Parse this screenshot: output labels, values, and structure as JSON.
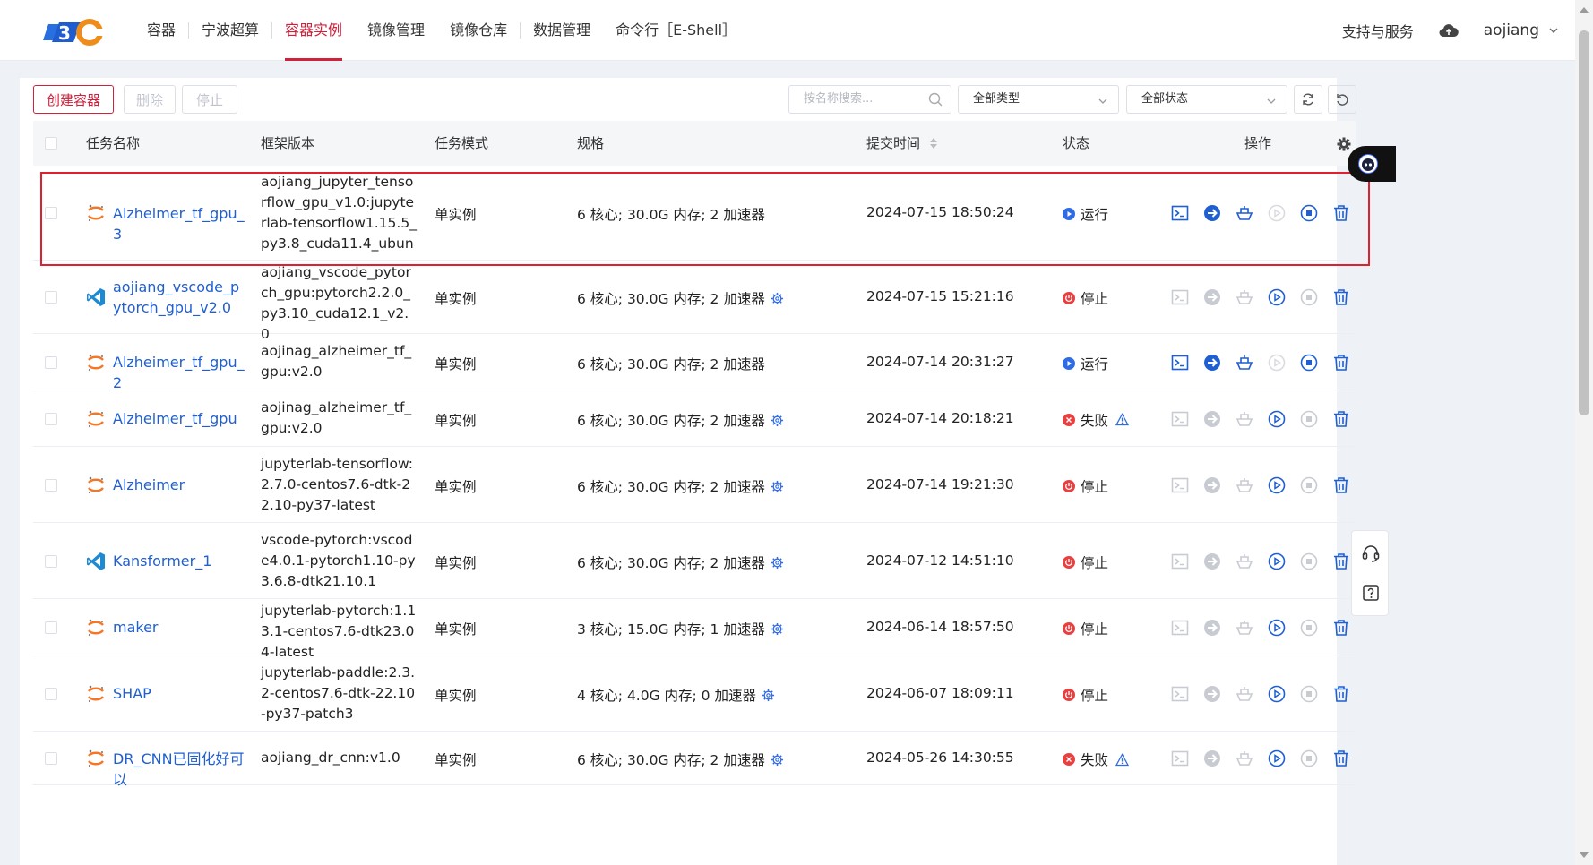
{
  "topbar": {
    "nav": [
      "容器",
      "宁波超算",
      "容器实例",
      "镜像管理",
      "镜像仓库",
      "数据管理",
      "命令行［E-Shell］"
    ],
    "active_nav": "容器实例",
    "support": "支持与服务",
    "user": "aojiang"
  },
  "toolbar": {
    "create": "创建容器",
    "delete": "删除",
    "stop": "停止",
    "search_placeholder": "按名称搜索...",
    "type_select": "全部类型",
    "status_select": "全部状态"
  },
  "table": {
    "headers": {
      "name": "任务名称",
      "framework": "框架版本",
      "mode": "任务模式",
      "spec": "规格",
      "time": "提交时间",
      "status": "状态",
      "ops": "操作"
    },
    "rows": [
      {
        "icon": "jupyter-icon",
        "name": "Alzheimer_tf_gpu_3",
        "framework": "aojiang_jupyter_tensorflow_gpu_v1.0:jupyterlab-tensorflow1.15.5_py3.8_cuda11.4_ubun",
        "mode": "单实例",
        "spec": "6 核心; 30.0G 内存; 2 加速器",
        "spec_gear": false,
        "time": "2024-07-15 18:50:24",
        "status": "运行",
        "status_kind": "running",
        "warn": false
      },
      {
        "icon": "vscode-icon",
        "name": "aojiang_vscode_pytorch_gpu_v2.0",
        "framework": "aojiang_vscode_pytorch_gpu:pytorch2.2.0_py3.10_cuda12.1_v2.0",
        "mode": "单实例",
        "spec": "6 核心; 30.0G 内存; 2 加速器",
        "spec_gear": true,
        "time": "2024-07-15 15:21:16",
        "status": "停止",
        "status_kind": "stopped",
        "warn": false
      },
      {
        "icon": "jupyter-icon",
        "name": "Alzheimer_tf_gpu_2",
        "framework": "aojinag_alzheimer_tf_gpu:v2.0",
        "mode": "单实例",
        "spec": "6 核心; 30.0G 内存; 2 加速器",
        "spec_gear": false,
        "time": "2024-07-14 20:31:27",
        "status": "运行",
        "status_kind": "running",
        "warn": false
      },
      {
        "icon": "jupyter-icon",
        "name": "Alzheimer_tf_gpu",
        "framework": "aojinag_alzheimer_tf_gpu:v2.0",
        "mode": "单实例",
        "spec": "6 核心; 30.0G 内存; 2 加速器",
        "spec_gear": true,
        "time": "2024-07-14 20:18:21",
        "status": "失败",
        "status_kind": "failed",
        "warn": true
      },
      {
        "icon": "jupyter-icon",
        "name": "Alzheimer",
        "framework": "jupyterlab-tensorflow:2.7.0-centos7.6-dtk-22.10-py37-latest",
        "mode": "单实例",
        "spec": "6 核心; 30.0G 内存; 2 加速器",
        "spec_gear": true,
        "time": "2024-07-14 19:21:30",
        "status": "停止",
        "status_kind": "stopped",
        "warn": false
      },
      {
        "icon": "vscode-icon",
        "name": "Kansformer_1",
        "framework": "vscode-pytorch:vscode4.0.1-pytorch1.10-py3.6.8-dtk21.10.1",
        "mode": "单实例",
        "spec": "6 核心; 30.0G 内存; 2 加速器",
        "spec_gear": true,
        "time": "2024-07-12 14:51:10",
        "status": "停止",
        "status_kind": "stopped",
        "warn": false
      },
      {
        "icon": "jupyter-icon",
        "name": "maker",
        "framework": "jupyterlab-pytorch:1.13.1-centos7.6-dtk23.04-latest",
        "mode": "单实例",
        "spec": "3 核心; 15.0G 内存; 1 加速器",
        "spec_gear": true,
        "time": "2024-06-14 18:57:50",
        "status": "停止",
        "status_kind": "stopped",
        "warn": false
      },
      {
        "icon": "jupyter-icon",
        "name": "SHAP",
        "framework": "jupyterlab-paddle:2.3.2-centos7.6-dtk-22.10-py37-patch3",
        "mode": "单实例",
        "spec": "4 核心; 4.0G 内存; 0 加速器",
        "spec_gear": true,
        "time": "2024-06-07 18:09:11",
        "status": "停止",
        "status_kind": "stopped",
        "warn": false
      },
      {
        "icon": "jupyter-icon",
        "name": "DR_CNN已固化好可以",
        "framework": "aojiang_dr_cnn:v1.0",
        "mode": "单实例",
        "spec": "6 核心; 30.0G 内存; 2 加速器",
        "spec_gear": true,
        "time": "2024-05-26 14:30:55",
        "status": "失败",
        "status_kind": "failed",
        "warn": true
      }
    ]
  },
  "colors": {
    "accent_red": "#d0203a",
    "link_blue": "#1f5fd1",
    "running_blue": "#2e6ce6",
    "stopped_red": "#e84040",
    "failed_red": "#e84040"
  }
}
